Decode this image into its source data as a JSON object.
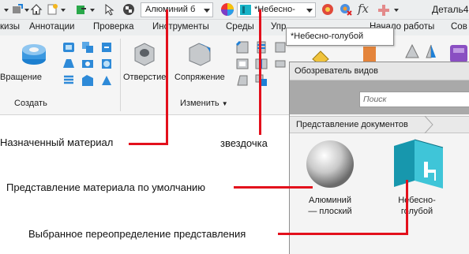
{
  "quick_access": {
    "material_combo": "Алюминий б",
    "appearance_combo": "*Небесно-",
    "function_icon": "fx",
    "document_title": "Деталь4"
  },
  "ribbon_tabs": [
    "кизы",
    "Аннотации",
    "Проверка",
    "Инструменты",
    "Среды",
    "Упр",
    "Начало работы",
    "Сов"
  ],
  "ribbon": {
    "create_panel": {
      "revolve_label": "Вращение",
      "panel_label": "Создать"
    },
    "modify_panel": {
      "hole_label": "Отверстие",
      "fillet_label": "Сопряжение",
      "panel_label": "Изменить",
      "panel_caret": "▼"
    }
  },
  "tooltip": "*Небесно-голубой",
  "views_browser": {
    "title": "Обозреватель видов",
    "search_placeholder": "Поиск",
    "breadcrumb": "Представление документов",
    "items": [
      {
        "label": "Алюминий\n— плоский"
      },
      {
        "label": "Небесно-\nголубой"
      }
    ]
  },
  "callouts": {
    "assigned_material": "Назначенный материал",
    "asterisk": "звездочка",
    "default_appearance": "Представление материала по умолчанию",
    "override": "Выбранное переопределение представления"
  },
  "colors": {
    "callout_line": "#e3101c",
    "accent_blue": "#1e7fd6",
    "appearance_cyan": "#17b3c7"
  }
}
